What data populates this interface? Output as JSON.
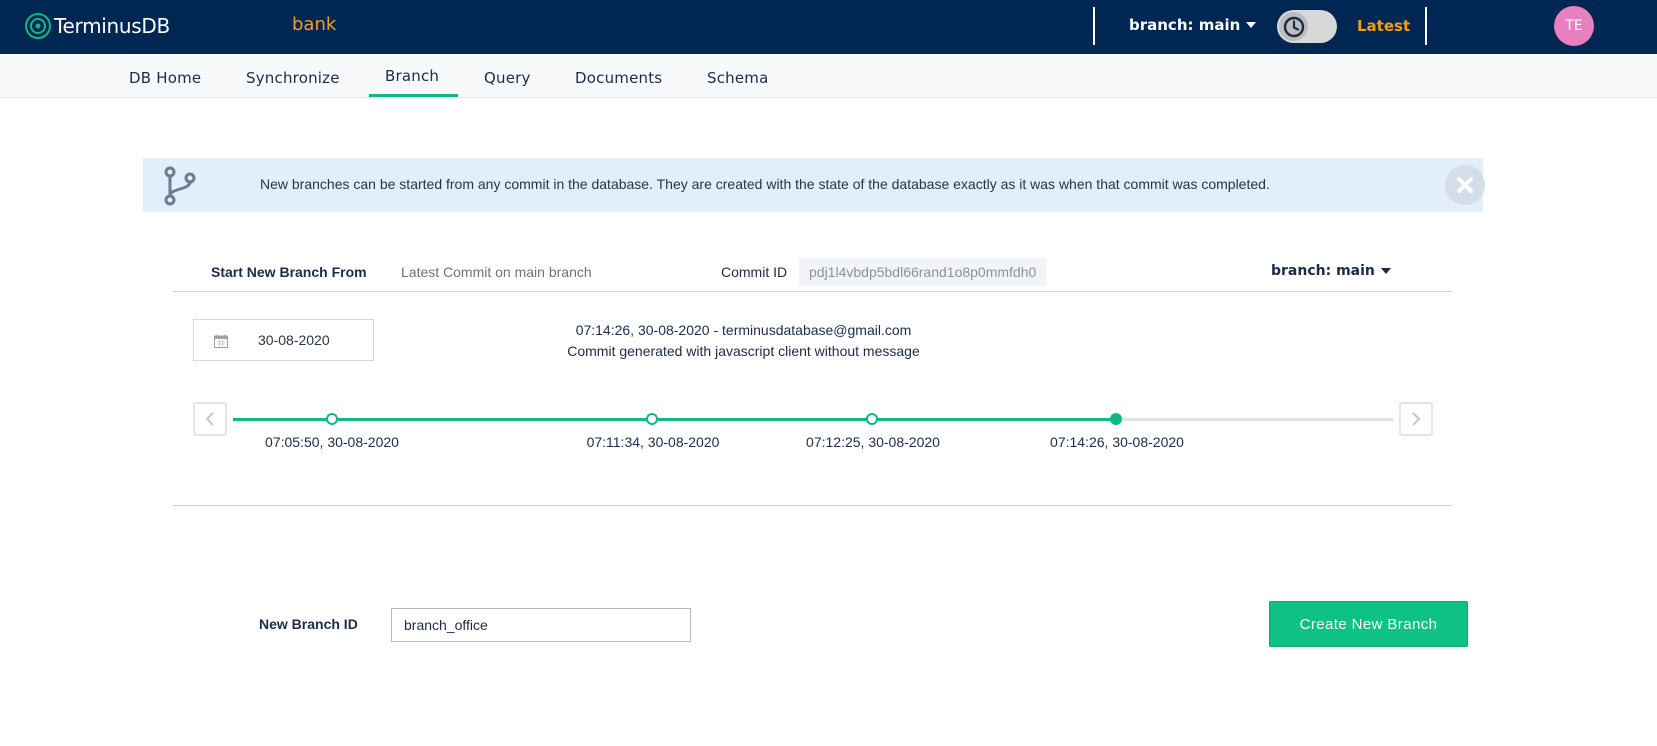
{
  "app": {
    "logo_text": "TerminusDB",
    "db_name": "bank",
    "branch_selector": "branch: main",
    "time_travel_label": "Latest",
    "avatar_initials": "TE"
  },
  "nav": {
    "items": [
      {
        "label": "DB Home"
      },
      {
        "label": "Synchronize"
      },
      {
        "label": "Branch",
        "active": true
      },
      {
        "label": "Query"
      },
      {
        "label": "Documents"
      },
      {
        "label": "Schema"
      }
    ]
  },
  "banner": {
    "text": "New branches can be started from any commit in the database. They are created with the state of the database exactly as it was when that commit was completed.",
    "icon": "git-branch-icon",
    "close_icon": "close-icon"
  },
  "start_from": {
    "label": "Start New Branch From",
    "value": "Latest Commit on main branch",
    "commit_id_label": "Commit ID",
    "commit_id": "pdj1l4vbdp5bdl66rand1o8p0mmfdh0",
    "branch_selector": "branch: main"
  },
  "date_picker": {
    "value": "30-08-2020",
    "icon": "calendar-icon"
  },
  "commit_info": {
    "line1": "07:14:26, 30-08-2020 - terminusdatabase@gmail.com",
    "line2": "Commit generated with javascript client without message"
  },
  "timeline": {
    "prev_icon": "chevron-left-icon",
    "next_icon": "chevron-right-icon",
    "commits": [
      {
        "label": "07:05:50, 30-08-2020",
        "active": false
      },
      {
        "label": "07:11:34, 30-08-2020",
        "active": false
      },
      {
        "label": "07:12:25, 30-08-2020",
        "active": false
      },
      {
        "label": "07:14:26, 30-08-2020",
        "active": true
      }
    ]
  },
  "new_branch": {
    "label": "New Branch ID",
    "value": "branch_office",
    "button_label": "Create New Branch"
  },
  "colors": {
    "header_bg": "#002654",
    "accent_orange": "#f59e1b",
    "accent_green": "#10b981",
    "banner_bg": "#e3eefb",
    "avatar_bg": "#e87fbf"
  }
}
